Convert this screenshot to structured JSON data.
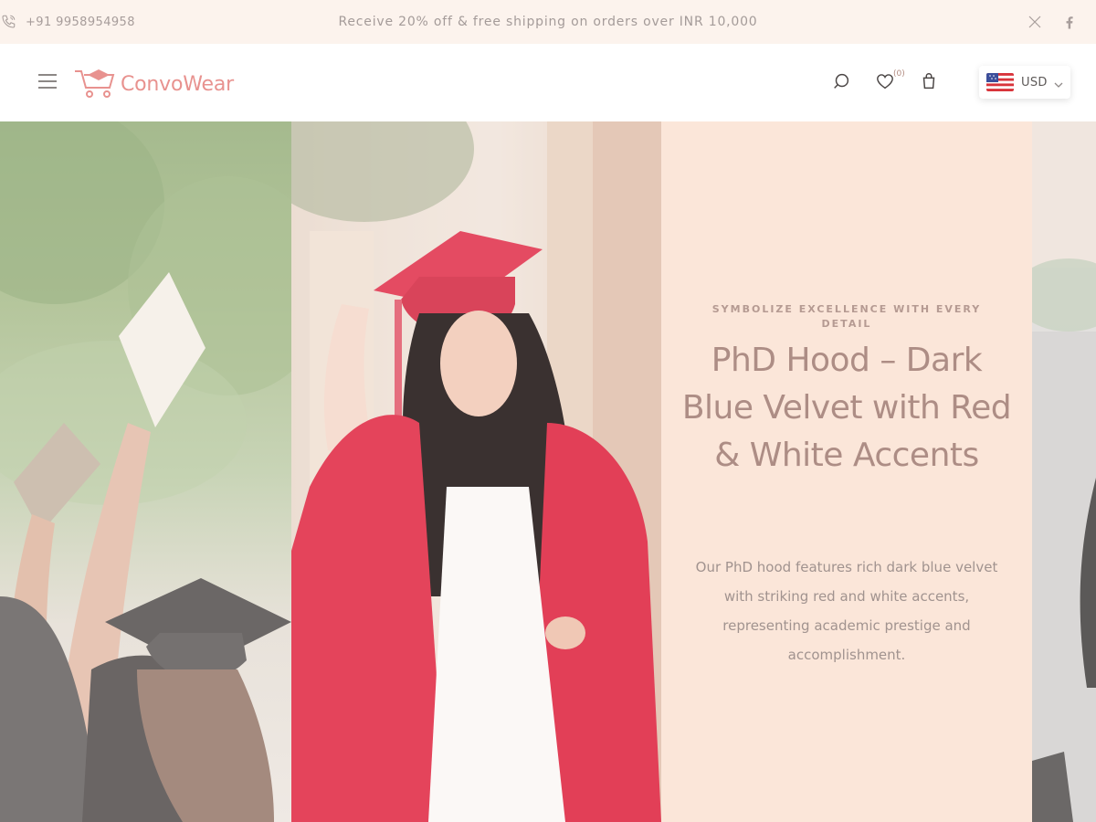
{
  "announcement": {
    "phone": "+91 9958954958",
    "promo": "Receive 20% off & free shipping on orders over INR 10,000",
    "social": [
      {
        "icon": "x-twitter-icon"
      },
      {
        "icon": "facebook-icon"
      }
    ]
  },
  "header": {
    "logo_text": "ConvoWear",
    "wishlist_count": "(0)",
    "currency": {
      "code": "USD",
      "flag": "us-flag-icon"
    }
  },
  "hero": {
    "eyebrow": "SYMBOLIZE EXCELLENCE WITH EVERY DETAIL",
    "title": "PhD Hood – Dark Blue Velvet with Red & White Accents",
    "description": "Our PhD hood features rich dark blue velvet with striking red and white accents, representing academic prestige and accomplishment."
  },
  "colors": {
    "announcement_bg": "#fcf3ed",
    "brand": "#e8928f",
    "text_panel_bg": "#fbe6d9",
    "title_color": "#ad8d85"
  }
}
